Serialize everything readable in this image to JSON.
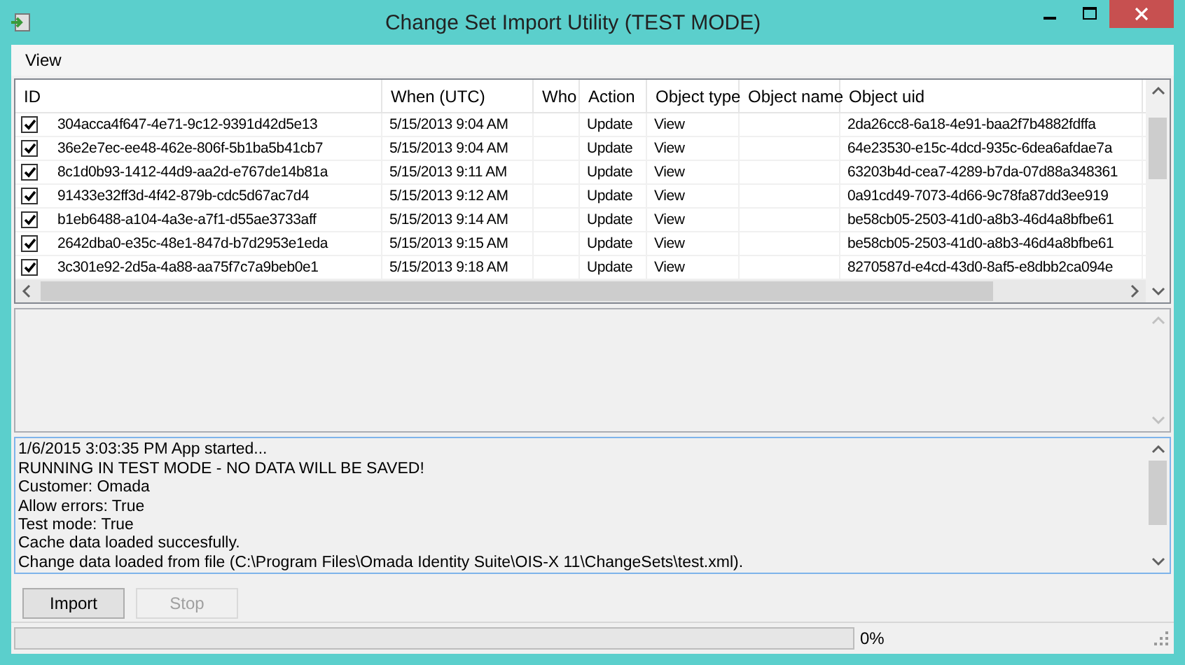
{
  "window": {
    "title": "Change Set Import Utility (TEST MODE)"
  },
  "menu": [
    "View"
  ],
  "table": {
    "columns": [
      "ID",
      "When (UTC)",
      "Who",
      "Action",
      "Object type",
      "Object name",
      "Object uid"
    ],
    "rows": [
      {
        "checked": true,
        "cells": [
          "304acca4f647-4e71-9c12-9391d42d5e13",
          "5/15/2013 9:04 AM",
          "",
          "Update",
          "View",
          "",
          "2da26cc8-6a18-4e91-baa2f7b4882fdffa"
        ]
      },
      {
        "checked": true,
        "cells": [
          "36e2e7ec-ee48-462e-806f-5b1ba5b41cb7",
          "5/15/2013 9:04 AM",
          "",
          "Update",
          "View",
          "",
          "64e23530-e15c-4dcd-935c-6dea6afdae7a"
        ]
      },
      {
        "checked": true,
        "cells": [
          "8c1d0b93-1412-44d9-aa2d-e767de14b81a",
          "5/15/2013 9:11 AM",
          "",
          "Update",
          "View",
          "",
          "63203b4d-cea7-4289-b7da-07d88a348361"
        ]
      },
      {
        "checked": true,
        "cells": [
          "91433e32ff3d-4f42-879b-cdc5d67ac7d4",
          "5/15/2013 9:12 AM",
          "",
          "Update",
          "View",
          "",
          "0a91cd49-7073-4d66-9c78fa87dd3ee919"
        ]
      },
      {
        "checked": true,
        "cells": [
          "b1eb6488-a104-4a3e-a7f1-d55ae3733aff",
          "5/15/2013 9:14 AM",
          "",
          "Update",
          "View",
          "",
          "be58cb05-2503-41d0-a8b3-46d4a8bfbe61"
        ]
      },
      {
        "checked": true,
        "cells": [
          "2642dba0-e35c-48e1-847d-b7d2953e1eda",
          "5/15/2013 9:15 AM",
          "",
          "Update",
          "View",
          "",
          "be58cb05-2503-41d0-a8b3-46d4a8bfbe61"
        ]
      },
      {
        "checked": true,
        "cells": [
          "3c301e92-2d5a-4a88-aa75f7c7a9beb0e1",
          "5/15/2013 9:18 AM",
          "",
          "Update",
          "View",
          "",
          "8270587d-e4cd-43d0-8af5-e8dbb2ca094e"
        ]
      }
    ]
  },
  "log": [
    "1/6/2015 3:03:35 PM App started...",
    "RUNNING IN TEST MODE - NO DATA WILL BE SAVED!",
    "Customer: Omada",
    "Allow errors: True",
    "Test mode: True",
    "Cache data loaded succesfully.",
    "Change data loaded from file (C:\\Program Files\\Omada Identity Suite\\OIS-X 11\\ChangeSets\\test.xml)."
  ],
  "buttons": [
    {
      "label": "Import",
      "disabled": false
    },
    {
      "label": "Stop",
      "disabled": true
    }
  ],
  "progress": {
    "level": 0,
    "reading": "0%"
  }
}
